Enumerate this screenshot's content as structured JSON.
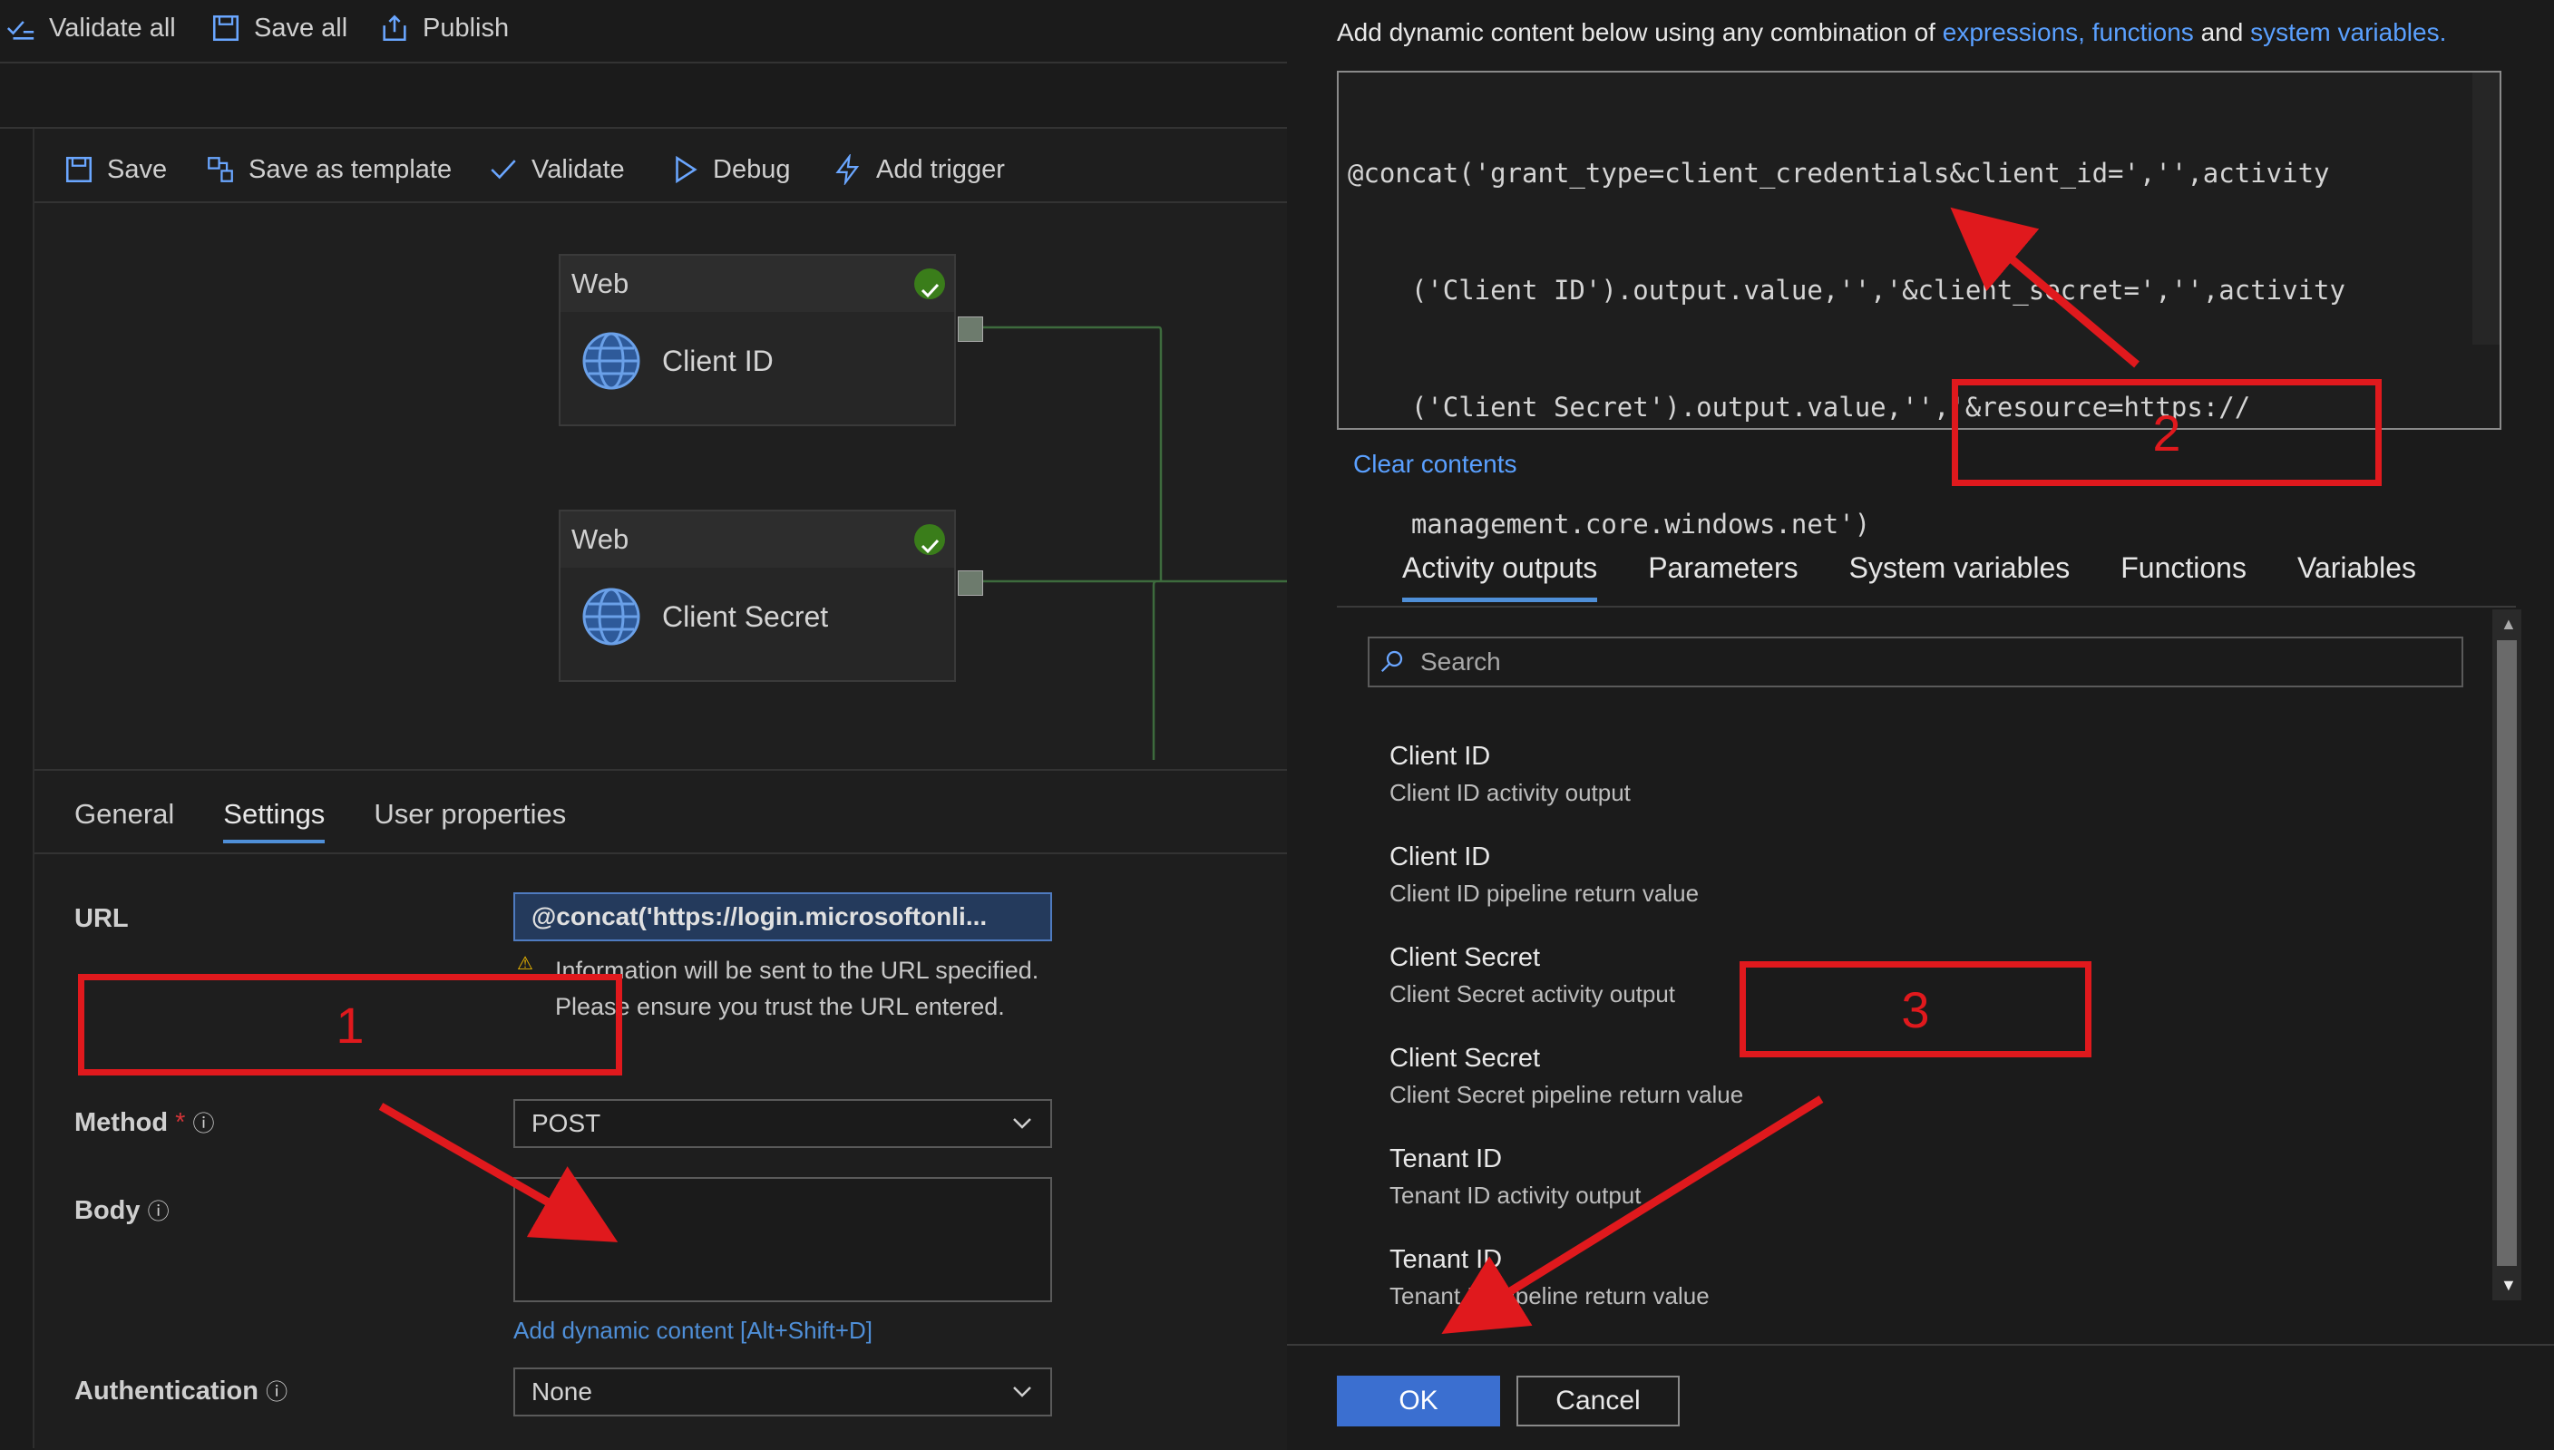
{
  "top_toolbar": {
    "validate_all": "Validate all",
    "save_all": "Save all",
    "publish": "Publish"
  },
  "pipeline_toolbar": {
    "save": "Save",
    "save_as_template": "Save as template",
    "validate": "Validate",
    "debug": "Debug",
    "add_trigger": "Add trigger"
  },
  "activities": [
    {
      "type": "Web",
      "name": "Client ID"
    },
    {
      "type": "Web",
      "name": "Client Secret"
    }
  ],
  "props": {
    "tabs": [
      "General",
      "Settings",
      "User properties"
    ],
    "active_tab": "Settings",
    "url_label": "URL",
    "url_value": "@concat('https://login.microsoftonli...",
    "warning": "Information will be sent to the URL specified. Please ensure you trust the URL entered.",
    "method_label": "Method",
    "method_required": "*",
    "method_value": "POST",
    "body_label": "Body",
    "add_dynamic": "Add dynamic content [Alt+Shift+D]",
    "auth_label": "Authentication",
    "auth_value": "None"
  },
  "annotations": {
    "box1": "1",
    "box2": "2",
    "box3": "3",
    "color": "#e0191d"
  },
  "dynamic": {
    "intro": "Add dynamic content below using any combination of",
    "link_expr": "expressions,",
    "link_funcs": "functions",
    "and": "and",
    "link_sysvars": "system variables.",
    "code_lines": [
      "@concat('grant_type=client_credentials&client_id=','',activity",
      "    ('Client ID').output.value,'','&client_secret=','',activity",
      "    ('Client Secret').output.value,'','&resource=https://",
      "    management.core.windows.net')"
    ],
    "clear": "Clear contents",
    "tabs": [
      "Activity outputs",
      "Parameters",
      "System variables",
      "Functions",
      "Variables"
    ],
    "active_tab": "Activity outputs",
    "search_placeholder": "Search",
    "items": [
      {
        "title": "Client ID",
        "desc": "Client ID activity output"
      },
      {
        "title": "Client ID",
        "desc": "Client ID pipeline return value"
      },
      {
        "title": "Client Secret",
        "desc": "Client Secret activity output"
      },
      {
        "title": "Client Secret",
        "desc": "Client Secret pipeline return value"
      },
      {
        "title": "Tenant ID",
        "desc": "Tenant ID activity output"
      },
      {
        "title": "Tenant ID",
        "desc": "Tenant ID pipeline return value"
      }
    ],
    "ok": "OK",
    "cancel": "Cancel"
  },
  "colors": {
    "accent": "#4f8fd8",
    "ok_button": "#3b6fd0",
    "success": "#3a7d1a"
  }
}
